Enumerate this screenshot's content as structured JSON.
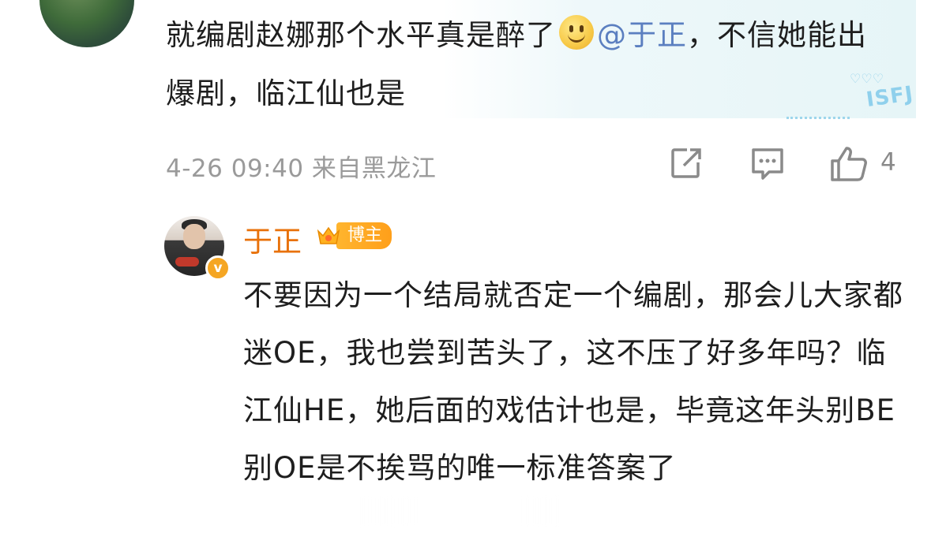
{
  "top_comment": {
    "text_before_emoji": "就编剧赵娜那个水平真是醉了",
    "mention": "@于正",
    "text_after_mention": "，不信她能出爆剧，临江仙也是",
    "emoji": "smile-emoji",
    "decoration_text": "ISFJ",
    "meta": {
      "date": "4-26",
      "time": "09:40",
      "location": "来自黑龙江"
    },
    "actions": {
      "share_icon": "share-icon",
      "comment_icon": "comment-icon",
      "like_icon": "thumbs-up-icon",
      "like_count": "4"
    }
  },
  "reply": {
    "author": "于正",
    "badge_label": "博主",
    "badge_icon": "crown-icon",
    "verified_mark": "v",
    "text": "不要因为一个结局就否定一个编剧，那会儿大家都迷OE，我也尝到苦头了，这不压了好多年吗？临江仙HE，她后面的戏估计也是，毕竟这年头别BE别OE是不挨骂的唯一标准答案了"
  },
  "colors": {
    "accent_name": "#e8710a",
    "mention": "#5b7fc0",
    "meta_gray": "#9a9a9a",
    "badge": "#ffa21f"
  }
}
